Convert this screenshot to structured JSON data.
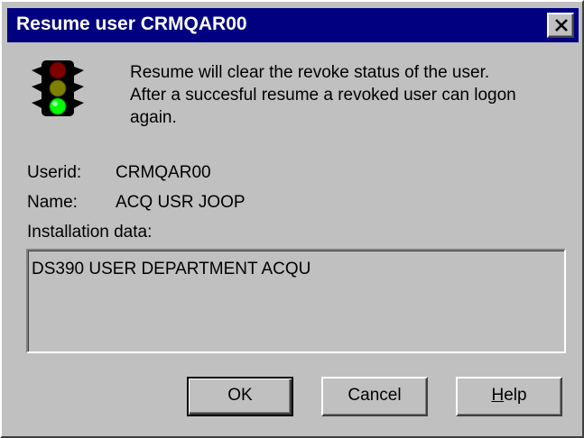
{
  "window": {
    "title": "Resume user CRMQAR00",
    "close_icon": "close-icon"
  },
  "icon": {
    "name": "traffic-light-icon",
    "colors": {
      "red": "#800000",
      "yellow": "#808000",
      "green": "#00ff00"
    }
  },
  "message": {
    "lines": [
      "Resume will clear the revoke status of the user.",
      "After a succesful resume a revoked user can logon",
      "again."
    ]
  },
  "fields": {
    "userid_label": "Userid:",
    "userid_value": "CRMQAR00",
    "name_label": "Name:",
    "name_value": "ACQ USR JOOP",
    "installation_label": "Installation data:",
    "installation_value": "DS390 USER DEPARTMENT ACQU"
  },
  "buttons": {
    "ok": "OK",
    "cancel": "Cancel",
    "help_mnemonic": "H",
    "help_rest": "elp"
  },
  "colors": {
    "title_bar": "#000080",
    "face": "#c0c0c0"
  }
}
